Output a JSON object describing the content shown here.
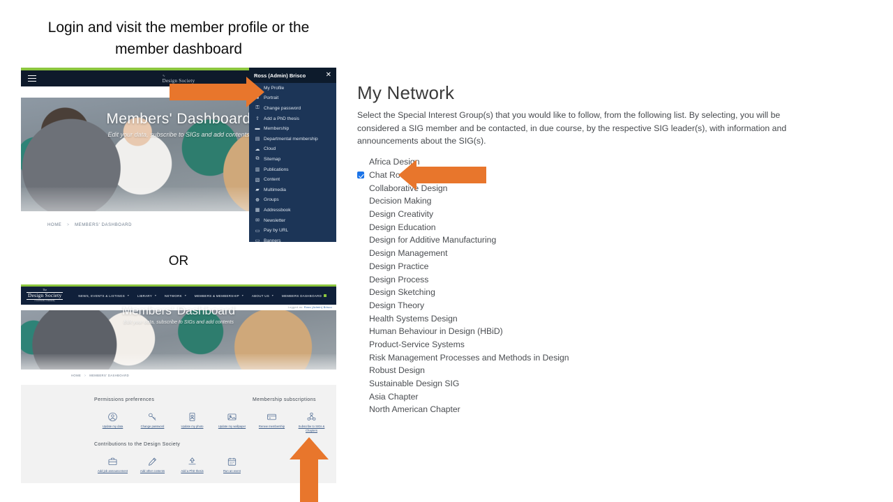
{
  "slide": {
    "title": "Login and visit the member profile or the member dashboard",
    "or_label": "OR",
    "accent_orange": "#e8762c",
    "accent_green": "#8cc63e",
    "accent_blue": "#1c3557",
    "link_blue": "#3a5a86"
  },
  "shot1": {
    "brand_top": "Тhe",
    "brand": "Design Society",
    "hero_title": "Members' Dashboard",
    "hero_subtitle": "Edit your data, subscribe to SIGs and add contents",
    "breadcrumb": [
      "HOME",
      "MEMBERS' DASHBOARD"
    ],
    "breadcrumb_sep": ">",
    "menu_icon": "hamburger-icon",
    "sidebar": {
      "user": "Ross (Admin) Brisco",
      "close_label": "✕",
      "items": [
        {
          "label": "My Profile",
          "icon": "user-circle-icon",
          "glyph": "●"
        },
        {
          "label": "Portrait",
          "icon": "portrait-icon",
          "glyph": "■"
        },
        {
          "label": "Change password",
          "icon": "key-icon",
          "glyph": "⚿"
        },
        {
          "label": "Add a PhD thesis",
          "icon": "upload-icon",
          "glyph": "⇧"
        },
        {
          "label": "Membership",
          "icon": "card-icon",
          "glyph": "▬"
        },
        {
          "label": "Departmental membership",
          "icon": "building-icon",
          "glyph": "▤"
        },
        {
          "label": "Cloud",
          "icon": "cloud-icon",
          "glyph": "☁"
        },
        {
          "label": "Sitemap",
          "icon": "sitemap-icon",
          "glyph": "⧉"
        },
        {
          "label": "Publications",
          "icon": "book-icon",
          "glyph": "▥"
        },
        {
          "label": "Content",
          "icon": "document-icon",
          "glyph": "▧"
        },
        {
          "label": "Multimedia",
          "icon": "folder-icon",
          "glyph": "▰"
        },
        {
          "label": "Groups",
          "icon": "groups-icon",
          "glyph": "☸"
        },
        {
          "label": "Addressbook",
          "icon": "addressbook-icon",
          "glyph": "▦"
        },
        {
          "label": "Newsletter",
          "icon": "newsletter-icon",
          "glyph": "✉"
        },
        {
          "label": "Pay by URL",
          "icon": "payment-icon",
          "glyph": "▭"
        },
        {
          "label": "Banners",
          "icon": "banner-icon",
          "glyph": "▭"
        }
      ]
    }
  },
  "shot2": {
    "brand_top": "The",
    "brand": "Design Society",
    "brand_sub": "a worldwide community",
    "nav_items": [
      {
        "label": "NEWS, EVENTS & LISTINGS",
        "has_caret": true
      },
      {
        "label": "LIBRARY",
        "has_caret": true
      },
      {
        "label": "NETWORK",
        "has_caret": true
      },
      {
        "label": "MEMBERS & MEMBERSHIP",
        "has_caret": true
      },
      {
        "label": "ABOUT US",
        "has_caret": true
      },
      {
        "label": "MEMBERS DASHBOARD",
        "has_caret": false
      }
    ],
    "logged_as_prefix": "Logged as:",
    "logged_as_user": "Ross (Admin) Brisco",
    "hero_title": "Members' Dashboard",
    "hero_subtitle": "Edit your data, subscribe to SIGs and add contents",
    "breadcrumb": [
      "HOME",
      "MEMBERS' DASHBOARD"
    ],
    "breadcrumb_sep": ">",
    "section_permissions": "Permissions  preferences",
    "section_membership": "Membership  subscriptions",
    "section_contributions": "Contributions to the Design Society",
    "permissions_icons": [
      {
        "label": "Update my data",
        "icon": "user-circle-icon"
      },
      {
        "label": "Change password",
        "icon": "key-icon"
      },
      {
        "label": "Update my photo",
        "icon": "portrait-photo-icon"
      },
      {
        "label": "Update my wallpaper",
        "icon": "image-icon"
      }
    ],
    "membership_icons": [
      {
        "label": "Renew membership",
        "icon": "credit-card-icon"
      },
      {
        "label": "Subscribe to SIGs & Chapters",
        "icon": "network-nodes-icon"
      }
    ],
    "contribution_icons": [
      {
        "label": "Add job announcement",
        "icon": "briefcase-icon"
      },
      {
        "label": "Add other contents",
        "icon": "pencil-icon"
      },
      {
        "label": "Add a PhD thesis",
        "icon": "upload-icon"
      },
      {
        "label": "Run an event",
        "icon": "calendar-icon"
      }
    ]
  },
  "network": {
    "title": "My Network",
    "description": "Select the Special Interest Group(s) that you would like to follow, from the following list. By selecting, you will be considered a SIG member and be contacted, in due course, by the respective SIG leader(s), with information and announcements about the SIG(s).",
    "sigs": [
      {
        "label": "Africa Design",
        "checked": false
      },
      {
        "label": "Chat Room",
        "checked": true
      },
      {
        "label": "Collaborative Design",
        "checked": false
      },
      {
        "label": "Decision Making",
        "checked": false
      },
      {
        "label": "Design Creativity",
        "checked": false
      },
      {
        "label": "Design Education",
        "checked": false
      },
      {
        "label": "Design for Additive Manufacturing",
        "checked": false
      },
      {
        "label": "Design Management",
        "checked": false
      },
      {
        "label": "Design Practice",
        "checked": false
      },
      {
        "label": "Design Process",
        "checked": false
      },
      {
        "label": "Design Sketching",
        "checked": false
      },
      {
        "label": "Design Theory",
        "checked": false
      },
      {
        "label": "Health Systems Design",
        "checked": false
      },
      {
        "label": "Human Behaviour in Design (HBiD)",
        "checked": false
      },
      {
        "label": "Product-Service Systems",
        "checked": false
      },
      {
        "label": "Risk Management Processes and Methods in Design",
        "checked": false
      },
      {
        "label": "Robust Design",
        "checked": false
      },
      {
        "label": "Sustainable Design SIG",
        "checked": false
      },
      {
        "label": "Asia Chapter",
        "checked": false
      },
      {
        "label": "North American Chapter",
        "checked": false
      }
    ]
  },
  "annotations": {
    "arrow_profile": "arrow-pointing-to-my-profile",
    "arrow_chat_room": "arrow-pointing-to-chat-room",
    "arrow_subscribe": "arrow-pointing-to-subscribe-to-sigs"
  }
}
